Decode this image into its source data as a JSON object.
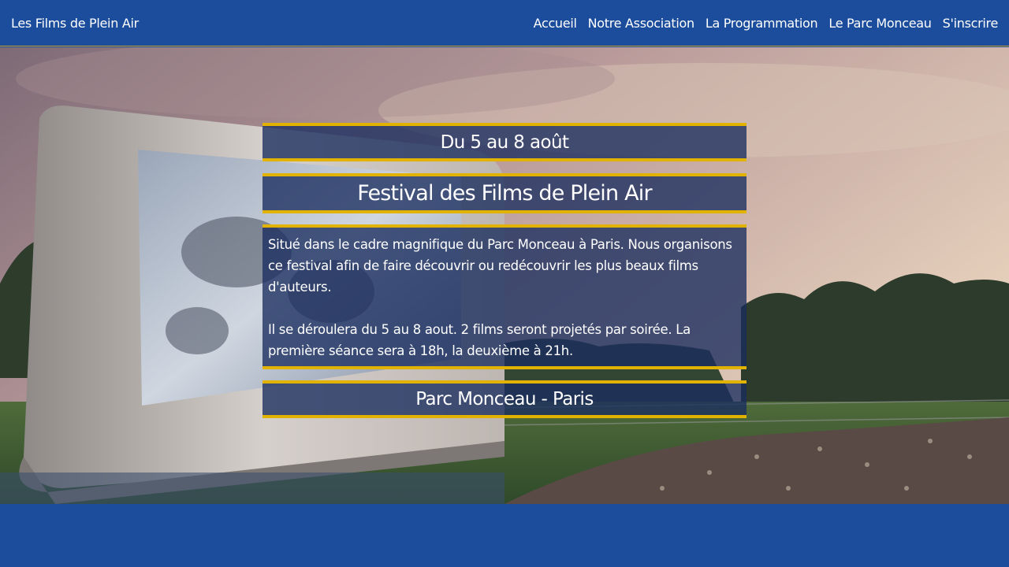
{
  "header": {
    "brand": "Les Films de Plein Air",
    "nav": [
      {
        "label": "Accueil"
      },
      {
        "label": "Notre Association"
      },
      {
        "label": "La Programmation"
      },
      {
        "label": "Le Parc Monceau"
      },
      {
        "label": "S'inscrire"
      }
    ]
  },
  "hero": {
    "dates": "Du 5 au 8 août",
    "title": "Festival des Films de Plein Air",
    "description": [
      "Situé dans le cadre magnifique du Parc Monceau à Paris. Nous organisons ce festival afin de faire découvrir ou redécouvrir les plus beaux films d'auteurs.",
      "Il se déroulera du 5 au 8 aout. 2 films seront projetés par soirée. La première séance sera à 18h, la deuxième à 21h."
    ],
    "location": "Parc Monceau - Paris"
  },
  "colors": {
    "primary": "#1b4d9c",
    "accent": "#e2b200",
    "panel": "#192d5f"
  }
}
